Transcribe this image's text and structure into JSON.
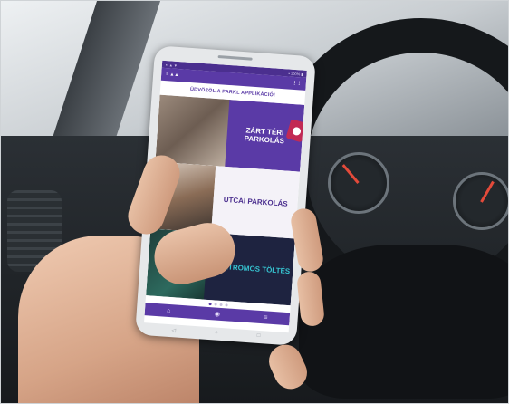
{
  "app": {
    "status_left": "▪▪ ▲ ▼",
    "status_right": "▪ 100% ▮",
    "appbar_left": "≡ ▲▲",
    "appbar_right": "⋮⋮",
    "greeting": "ÜDVÖZÖL A PARKL APPLIKÁCIÓ!"
  },
  "cards": [
    {
      "label": "ZÁRT TÉRI PARKOLÁS",
      "bg_color": "#5a3aa6",
      "text_color": "#ffffff"
    },
    {
      "label": "UTCAI PARKOLÁS",
      "bg_color": "#f4f2f8",
      "text_color": "#4b2f8f"
    },
    {
      "label": "ELEKTROMOS TÖLTÉS",
      "bg_color": "#1e2340",
      "text_color": "#36c3d0"
    }
  ],
  "carousel": {
    "count": 4,
    "active_index": 0
  },
  "navbar": {
    "icons": [
      "home-icon",
      "map-pin-icon",
      "list-icon"
    ],
    "glyphs": [
      "⌂",
      "◉",
      "≡"
    ]
  },
  "system_nav": {
    "icons": [
      "back-icon",
      "home-circle-icon",
      "recent-apps-icon"
    ],
    "glyphs": [
      "◁",
      "○",
      "□"
    ]
  },
  "colors": {
    "brand_purple": "#5a3aa6",
    "brand_dark": "#4b2f8f",
    "accent_teal": "#36c3d0",
    "accent_red": "#c22a54"
  }
}
